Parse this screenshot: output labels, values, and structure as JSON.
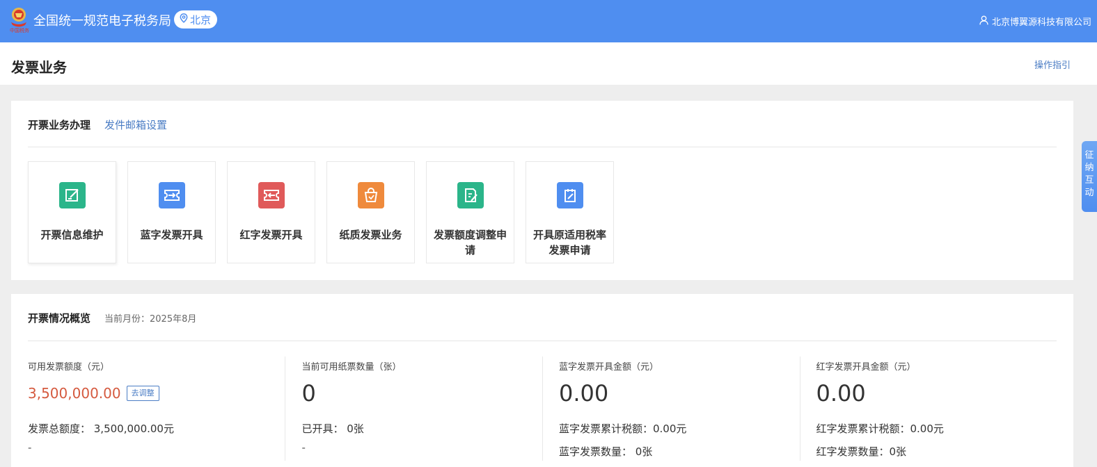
{
  "topbar": {
    "app_title": "全国统一规范电子税务局",
    "location": "北京",
    "company": "北京博翼源科技有限公司"
  },
  "header": {
    "page_title": "发票业务",
    "guide_link": "操作指引"
  },
  "business": {
    "title": "开票业务办理",
    "mail_link": "发件邮箱设置",
    "tiles": [
      {
        "label": "开票信息维护",
        "icon": "edit-square-icon",
        "color": "#2bb58a"
      },
      {
        "label": "蓝字发票开具",
        "icon": "ticket-in-icon",
        "color": "#4f8ef0"
      },
      {
        "label": "红字发票开具",
        "icon": "ticket-out-icon",
        "color": "#e05a5a"
      },
      {
        "label": "纸质发票业务",
        "icon": "bag-icon",
        "color": "#ef8a3c"
      },
      {
        "label": "发票额度调整申请",
        "icon": "doc-edit-icon",
        "color": "#2bb58a"
      },
      {
        "label": "开具原适用税率发票申请",
        "icon": "notepad-icon",
        "color": "#4f8ef0"
      }
    ]
  },
  "overview": {
    "title": "开票情况概览",
    "current_month": "当前月份：2025年8月",
    "stats": [
      {
        "label": "可用发票额度（元）",
        "value": "3,500,000.00",
        "button": "去调整",
        "line1": "发票总额度： 3,500,000.00元",
        "dash": "-"
      },
      {
        "label": "当前可用纸票数量（张）",
        "value": "0",
        "line1": "已开具： 0张",
        "dash": "-"
      },
      {
        "label": "蓝字发票开具金额（元）",
        "value": "0.00",
        "line1": "蓝字发票累计税额：0.00元",
        "line2": "蓝字发票数量： 0张"
      },
      {
        "label": "红字发票开具金额（元）",
        "value": "0.00",
        "line1": "红字发票累计税额：0.00元",
        "line2": "红字发票数量：0张"
      }
    ]
  },
  "side_float": {
    "chars": [
      "征",
      "纳",
      "互",
      "动"
    ]
  }
}
